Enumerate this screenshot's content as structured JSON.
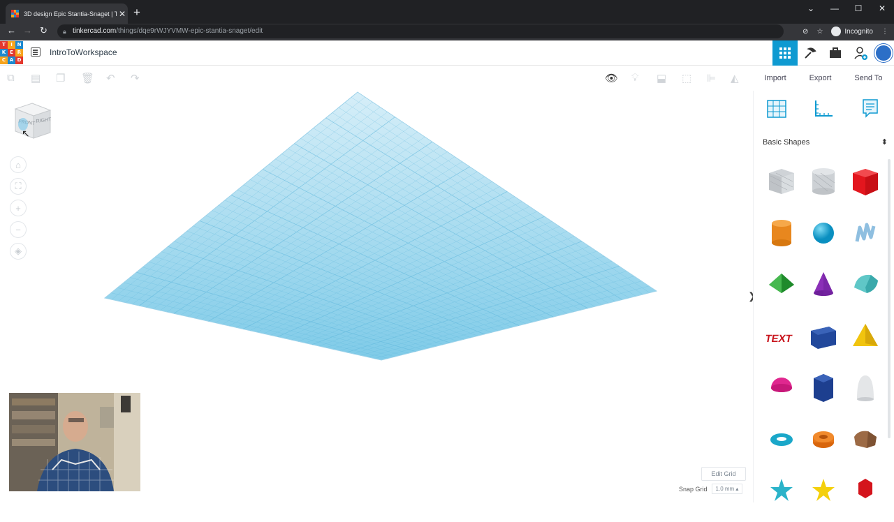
{
  "browser": {
    "tab_title": "3D design Epic Stantia-Snaget | T",
    "tab_close": "✕",
    "new_tab": "+",
    "url_host": "tinkercad.com",
    "url_path": "/things/dqe9rWJYVMW-epic-stantia-snaget/edit",
    "incognito_label": "Incognito",
    "window_controls": [
      "⌄",
      "—",
      "☐",
      "✕"
    ]
  },
  "app": {
    "logo_letters": [
      "T",
      "I",
      "N",
      "K",
      "E",
      "R",
      "C",
      "A",
      "D"
    ],
    "logo_colors": [
      "#e4382e",
      "#f7a41d",
      "#1d8ad0",
      "#1d8ad0",
      "#e4382e",
      "#f7a41d",
      "#f7a41d",
      "#1d8ad0",
      "#e4382e"
    ],
    "workspace_name": "IntroToWorkspace",
    "accent": "#0f9ad1"
  },
  "actions": {
    "import": "Import",
    "export": "Export",
    "send_to": "Send To"
  },
  "canvas": {
    "edit_grid": "Edit Grid",
    "snap_grid_label": "Snap Grid",
    "snap_grid_value": "1.0 mm ▴",
    "viewcube_front": "FRONT",
    "viewcube_right": "RIGHT",
    "collapse_arrow": "❯"
  },
  "panel": {
    "category": "Basic Shapes",
    "select_arrows": "⬍"
  }
}
